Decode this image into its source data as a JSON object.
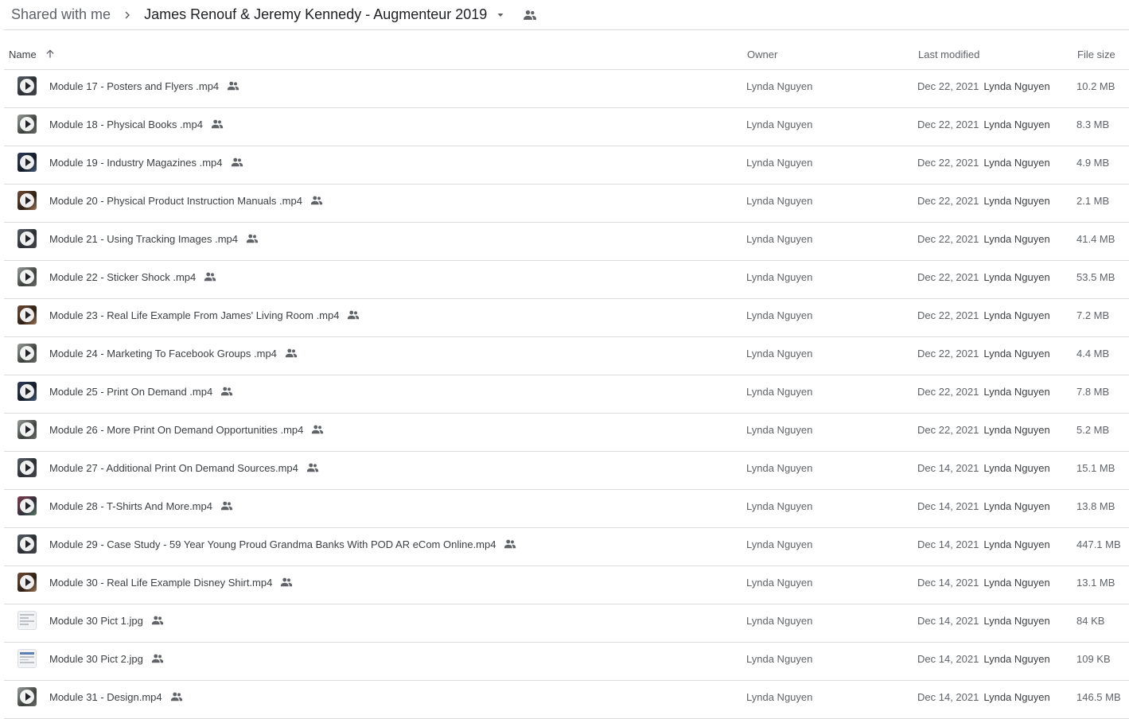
{
  "breadcrumb": {
    "root_label": "Shared with me",
    "current_folder": "James Renouf & Jeremy Kennedy - Augmenteur 2019"
  },
  "columns": {
    "name": "Name",
    "owner": "Owner",
    "last_modified": "Last modified",
    "file_size": "File size",
    "sort": "ascending"
  },
  "colors": {
    "text_primary": "#3c4043",
    "text_secondary": "#5f6368",
    "divider": "#dadce0"
  },
  "files": [
    {
      "name": "Module 17 - Posters and Flyers .mp4",
      "kind": "video",
      "owner": "Lynda Nguyen",
      "modified_date": "Dec 22, 2021",
      "modified_by": "Lynda Nguyen",
      "size": "10.2 MB"
    },
    {
      "name": "Module 18 - Physical Books .mp4",
      "kind": "video",
      "owner": "Lynda Nguyen",
      "modified_date": "Dec 22, 2021",
      "modified_by": "Lynda Nguyen",
      "size": "8.3 MB"
    },
    {
      "name": "Module 19 - Industry Magazines .mp4",
      "kind": "video",
      "owner": "Lynda Nguyen",
      "modified_date": "Dec 22, 2021",
      "modified_by": "Lynda Nguyen",
      "size": "4.9 MB"
    },
    {
      "name": "Module 20 - Physical Product Instruction Manuals .mp4",
      "kind": "video",
      "owner": "Lynda Nguyen",
      "modified_date": "Dec 22, 2021",
      "modified_by": "Lynda Nguyen",
      "size": "2.1 MB"
    },
    {
      "name": "Module 21 - Using Tracking Images .mp4",
      "kind": "video",
      "owner": "Lynda Nguyen",
      "modified_date": "Dec 22, 2021",
      "modified_by": "Lynda Nguyen",
      "size": "41.4 MB"
    },
    {
      "name": "Module 22 - Sticker Shock .mp4",
      "kind": "video",
      "owner": "Lynda Nguyen",
      "modified_date": "Dec 22, 2021",
      "modified_by": "Lynda Nguyen",
      "size": "53.5 MB"
    },
    {
      "name": "Module 23 - Real Life Example From James' Living Room .mp4",
      "kind": "video",
      "owner": "Lynda Nguyen",
      "modified_date": "Dec 22, 2021",
      "modified_by": "Lynda Nguyen",
      "size": "7.2 MB"
    },
    {
      "name": "Module 24 - Marketing To Facebook Groups .mp4",
      "kind": "video",
      "owner": "Lynda Nguyen",
      "modified_date": "Dec 22, 2021",
      "modified_by": "Lynda Nguyen",
      "size": "4.4 MB"
    },
    {
      "name": "Module 25 - Print On Demand .mp4",
      "kind": "video",
      "owner": "Lynda Nguyen",
      "modified_date": "Dec 22, 2021",
      "modified_by": "Lynda Nguyen",
      "size": "7.8 MB"
    },
    {
      "name": "Module 26 - More Print On Demand Opportunities .mp4",
      "kind": "video",
      "owner": "Lynda Nguyen",
      "modified_date": "Dec 22, 2021",
      "modified_by": "Lynda Nguyen",
      "size": "5.2 MB"
    },
    {
      "name": "Module 27 - Additional Print On Demand Sources.mp4",
      "kind": "video",
      "owner": "Lynda Nguyen",
      "modified_date": "Dec 14, 2021",
      "modified_by": "Lynda Nguyen",
      "size": "15.1 MB"
    },
    {
      "name": "Module 28 - T-Shirts And More.mp4",
      "kind": "video",
      "owner": "Lynda Nguyen",
      "modified_date": "Dec 14, 2021",
      "modified_by": "Lynda Nguyen",
      "size": "13.8 MB"
    },
    {
      "name": "Module 29 - Case Study - 59 Year Young Proud Grandma Banks With POD AR eCom Online.mp4",
      "kind": "video",
      "owner": "Lynda Nguyen",
      "modified_date": "Dec 14, 2021",
      "modified_by": "Lynda Nguyen",
      "size": "447.1 MB"
    },
    {
      "name": "Module 30 - Real Life Example Disney Shirt.mp4",
      "kind": "video",
      "owner": "Lynda Nguyen",
      "modified_date": "Dec 14, 2021",
      "modified_by": "Lynda Nguyen",
      "size": "13.1 MB"
    },
    {
      "name": "Module 30 Pict 1.jpg",
      "kind": "image",
      "owner": "Lynda Nguyen",
      "modified_date": "Dec 14, 2021",
      "modified_by": "Lynda Nguyen",
      "size": "84 KB"
    },
    {
      "name": "Module 30 Pict 2.jpg",
      "kind": "image",
      "owner": "Lynda Nguyen",
      "modified_date": "Dec 14, 2021",
      "modified_by": "Lynda Nguyen",
      "size": "109 KB"
    },
    {
      "name": "Module 31 - Design.mp4",
      "kind": "video",
      "owner": "Lynda Nguyen",
      "modified_date": "Dec 14, 2021",
      "modified_by": "Lynda Nguyen",
      "size": "146.5 MB"
    }
  ]
}
